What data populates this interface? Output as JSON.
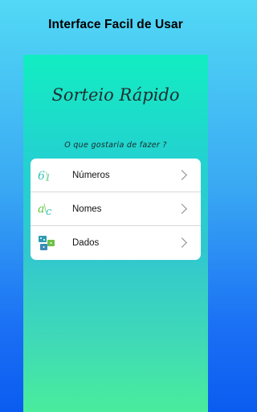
{
  "promo": {
    "title": "Interface Facil de Usar"
  },
  "app": {
    "title": "Sorteio Rápido",
    "prompt": "O que gostaria de fazer ?"
  },
  "menu": {
    "items": [
      {
        "label": "Números",
        "icon": "numbers-icon"
      },
      {
        "label": "Nomes",
        "icon": "names-icon"
      },
      {
        "label": "Dados",
        "icon": "dice-icon"
      }
    ]
  },
  "colors": {
    "outer_background_top": "#52d9f5",
    "outer_background_bottom": "#0a5cf0",
    "screen_gradient_top": "#12edc2",
    "screen_gradient_bottom": "#49ec9c",
    "card_background": "#ffffff",
    "icon_teal": "#2fc2b9",
    "icon_green": "#6cc24a"
  }
}
